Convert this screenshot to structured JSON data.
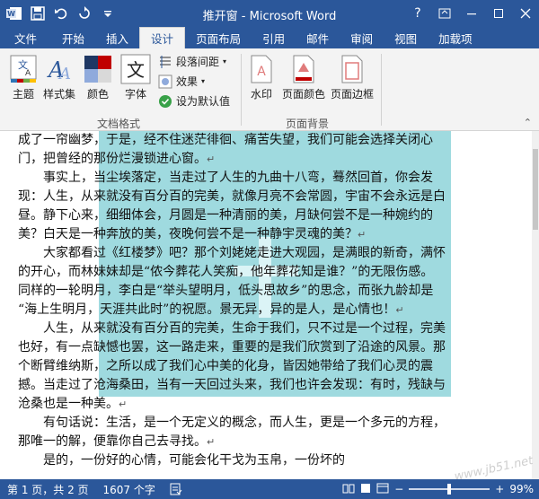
{
  "window": {
    "title": "推开窗 - Microsoft Word",
    "help": "?",
    "controls": [
      "restore",
      "minimize",
      "maximize",
      "close"
    ]
  },
  "qat": {
    "icons": [
      "word-icon",
      "save-icon",
      "undo-icon",
      "redo-icon",
      "customize-icon"
    ]
  },
  "tabs": [
    {
      "label": "文件"
    },
    {
      "label": "开始"
    },
    {
      "label": "插入"
    },
    {
      "label": "设计"
    },
    {
      "label": "页面布局"
    },
    {
      "label": "引用"
    },
    {
      "label": "邮件"
    },
    {
      "label": "审阅"
    },
    {
      "label": "视图"
    },
    {
      "label": "加载项"
    }
  ],
  "active_tab": "设计",
  "ribbon": {
    "doc_format": {
      "group_label": "文档格式",
      "theme": "主题",
      "style_set": "样式集",
      "colors": "颜色",
      "fonts": "字体",
      "paragraph_spacing": "段落间距",
      "effects": "效果",
      "set_default": "设为默认值"
    },
    "page_bg": {
      "group_label": "页面背景",
      "watermark": "水印",
      "page_color": "页面颜色",
      "page_border": "页面边框"
    }
  },
  "document": {
    "lines": [
      {
        "text": "成了一帘幽梦，于是，经不住迷茫徘徊、痛苦失望，我们可能会选择关闭心",
        "indent": false,
        "pm": false
      },
      {
        "text": "门，把曾经的那份烂漫锁进心窗。",
        "indent": false,
        "pm": true
      },
      {
        "text": "事实上，当尘埃落定，当走过了人生的九曲十八弯，蓦然回首，你会发",
        "indent": true,
        "pm": false
      },
      {
        "text": "现：人生，从来就没有百分百的完美，就像月亮不会常圆，宇宙不会永远是白",
        "indent": false,
        "pm": false
      },
      {
        "text": "昼。静下心来，细细体会，月圆是一种清丽的美，月缺何尝不是一种婉约的",
        "indent": false,
        "pm": false
      },
      {
        "text": "美？白天是一种奔放的美，夜晚何尝不是一种静宇灵魂的美？",
        "indent": false,
        "pm": true
      },
      {
        "text": "大家都看过《红楼梦》吧？那个刘姥姥走进大观园，是满眼的新奇，满怀",
        "indent": true,
        "pm": false
      },
      {
        "text": "的开心，而林妹妹却是“侬今葬花人笑痴，他年葬花知是谁？”的无限伤感。",
        "indent": false,
        "pm": false
      },
      {
        "text": "同样的一轮明月，李白是“举头望明月，低头思故乡”的思念，而张九龄却是",
        "indent": false,
        "pm": false
      },
      {
        "text": "“海上生明月，天涯共此时”的祝愿。景无异，异的是人，是心情也！",
        "indent": false,
        "pm": true
      },
      {
        "text": "人生，从来就没有百分百的完美，生命于我们，只不过是一个过程，完美",
        "indent": true,
        "pm": false
      },
      {
        "text": "也好，有一点缺憾也罢，这一路走来，重要的是我们欣赏到了沿途的风景。那",
        "indent": false,
        "pm": false
      },
      {
        "text": "个断臂维纳斯，之所以成了我们心中美的化身，皆因她带给了我们心灵的震",
        "indent": false,
        "pm": false
      },
      {
        "text": "撼。当走过了沧海桑田，当有一天回过头来，我们也许会发现：有时，残缺与",
        "indent": false,
        "pm": false
      },
      {
        "text": "沧桑也是一种美。",
        "indent": false,
        "pm": true
      },
      {
        "text": "有句话说：生活，是一个无定义的概念，而人生，更是一个多元的方程，",
        "indent": true,
        "pm": false
      },
      {
        "text": "那唯一的解，便靠你自己去寻找。",
        "indent": false,
        "pm": true
      },
      {
        "text": "是的，一份好的心情，可能会化干戈为玉帛，一份坏的",
        "indent": true,
        "pm": false
      }
    ],
    "paragraph_mark": "↵",
    "corner_watermark": "www.jb51.net"
  },
  "status": {
    "page": "第 1 页，共 2 页",
    "words": "1607 个字",
    "zoom": "99%",
    "zoom_minus": "−",
    "zoom_plus": "+",
    "zoom_value": 0.99
  },
  "colors": {
    "accent": "#2b579a",
    "watermark_fill": "#8ed4d9"
  }
}
